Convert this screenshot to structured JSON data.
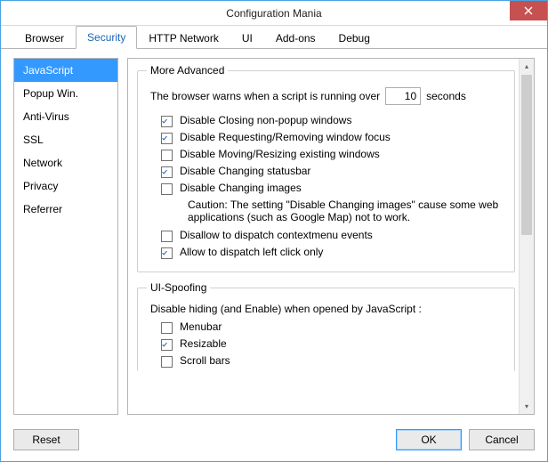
{
  "window": {
    "title": "Configuration Mania"
  },
  "tabs": [
    {
      "label": "Browser"
    },
    {
      "label": "Security"
    },
    {
      "label": "HTTP Network"
    },
    {
      "label": "UI"
    },
    {
      "label": "Add-ons"
    },
    {
      "label": "Debug"
    }
  ],
  "activeTab": 1,
  "sidebar": {
    "items": [
      {
        "label": "JavaScript"
      },
      {
        "label": "Popup Win."
      },
      {
        "label": "Anti-Virus"
      },
      {
        "label": "SSL"
      },
      {
        "label": "Network"
      },
      {
        "label": "Privacy"
      },
      {
        "label": "Referrer"
      }
    ],
    "selected": 0
  },
  "groups": {
    "moreAdvanced": {
      "legend": "More Advanced",
      "warnSentence": {
        "pre": "The browser warns when a script is running over",
        "value": "10",
        "post": "seconds"
      },
      "options": [
        {
          "checked": true,
          "label": "Disable Closing non-popup windows"
        },
        {
          "checked": true,
          "label": "Disable Requesting/Removing window focus"
        },
        {
          "checked": false,
          "label": "Disable Moving/Resizing existing windows"
        },
        {
          "checked": true,
          "label": "Disable Changing statusbar"
        },
        {
          "checked": false,
          "label": "Disable Changing images"
        }
      ],
      "caution": "Caution: The setting \"Disable Changing images\" cause some web applications (such as Google Map) not to work.",
      "options2": [
        {
          "checked": false,
          "label": "Disallow to dispatch contextmenu events"
        },
        {
          "checked": true,
          "label": "Allow to dispatch left click only"
        }
      ]
    },
    "uiSpoofing": {
      "legend": "UI-Spoofing",
      "subtext": "Disable hiding (and Enable) when opened by JavaScript :",
      "options": [
        {
          "checked": false,
          "label": "Menubar"
        },
        {
          "checked": true,
          "label": "Resizable"
        },
        {
          "checked": false,
          "label": "Scroll bars"
        }
      ]
    }
  },
  "footer": {
    "reset": "Reset",
    "ok": "OK",
    "cancel": "Cancel"
  }
}
